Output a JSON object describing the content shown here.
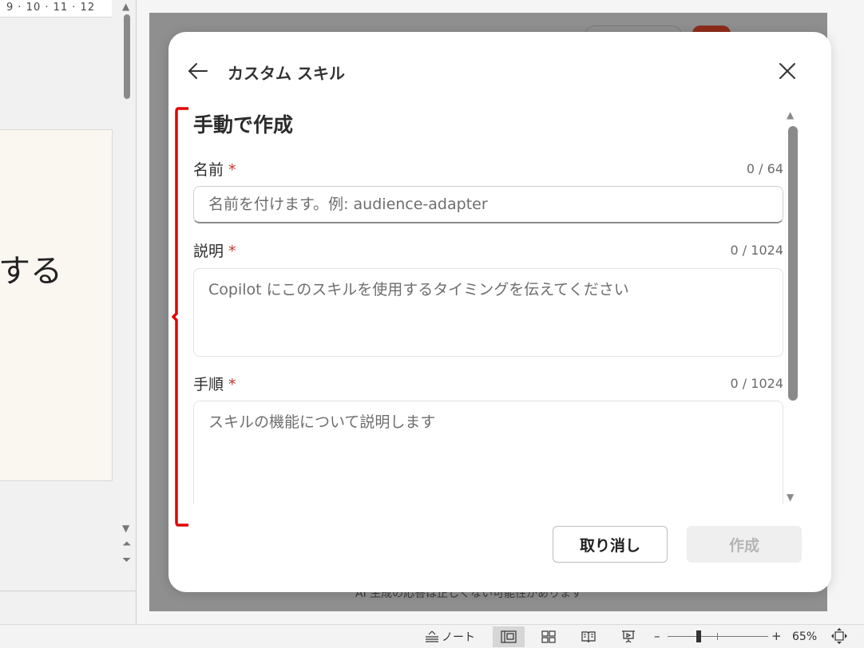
{
  "left_pane": {
    "ruler": "9 · 10 · 11 · 12",
    "slide_text": "する"
  },
  "background": {
    "footer_text": "AI 生成の応答は正しくない可能性があります"
  },
  "dialog": {
    "title": "カスタム スキル",
    "section_title": "手動で作成",
    "required_mark": "*",
    "fields": [
      {
        "label": "名前",
        "counter": "0 / 64",
        "value": "",
        "placeholder": "名前を付けます。例: audience-adapter"
      },
      {
        "label": "説明",
        "counter": "0 / 1024",
        "value": "",
        "placeholder": "Copilot にこのスキルを使用するタイミングを伝えてください"
      },
      {
        "label": "手順",
        "counter": "0 / 1024",
        "value": "",
        "placeholder": "スキルの機能について説明します"
      }
    ],
    "cancel_label": "取り消し",
    "create_label": "作成",
    "back_icon": "arrow-left-icon",
    "close_icon": "close-icon"
  },
  "status_bar": {
    "notes_label": "ノート",
    "zoom_minus": "–",
    "zoom_plus": "+",
    "zoom_value": "65%",
    "zoom_percent": 65,
    "views": [
      "normal-view-icon",
      "slide-sorter-icon",
      "reading-view-icon",
      "slideshow-icon"
    ]
  },
  "colors": {
    "required": "#c0392b",
    "annotation_bracket": "#e00000",
    "overlay": "#8f8f8f",
    "brand_red": "#8d2c1a"
  }
}
